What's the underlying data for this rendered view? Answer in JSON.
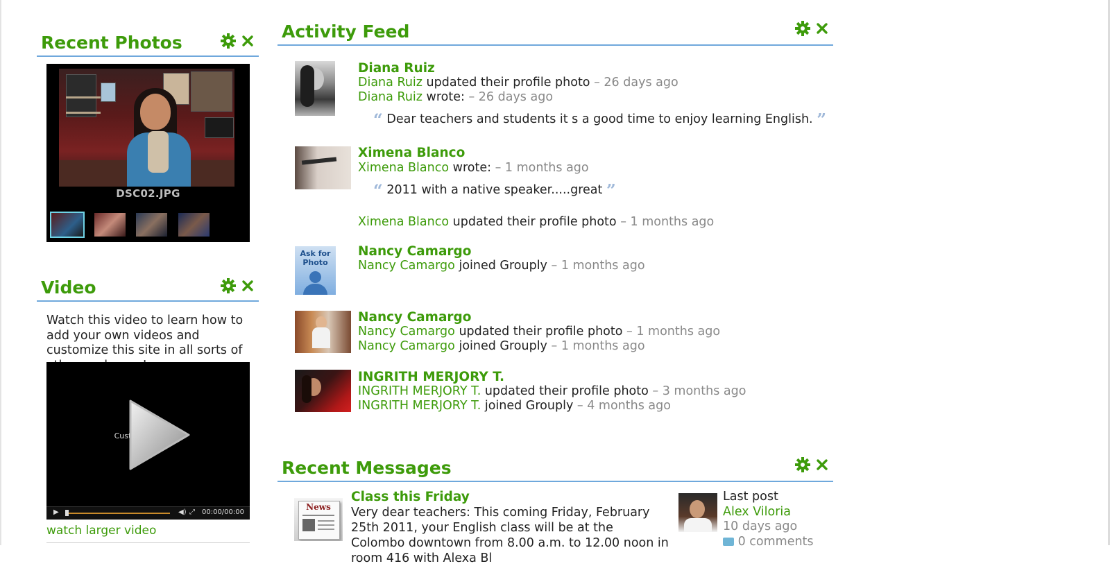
{
  "recent_photos": {
    "title": "Recent Photos",
    "caption": "DSC02.JPG",
    "thumbnail_count": 4,
    "settings_icon": "gear-icon",
    "close_icon": "close-icon"
  },
  "video": {
    "title": "Video",
    "description": "Watch this video to learn how to add your own videos and customize this site in all sorts of other cool ways!",
    "player_text": "Customize Videos",
    "time": "00:00/00:00",
    "watch_link": "watch larger video"
  },
  "activity_feed": {
    "title": "Activity Feed",
    "entries": [
      {
        "name": "Diana Ruiz",
        "lines": [
          {
            "name": "Diana Ruiz",
            "action": "updated their profile photo",
            "time": "– 26 days ago"
          },
          {
            "name": "Diana Ruiz",
            "action": "wrote:",
            "time": "– 26 days ago"
          }
        ],
        "quote": "Dear teachers and students it s a good time to enjoy learning English."
      },
      {
        "name": "Ximena Blanco",
        "lines": [
          {
            "name": "Ximena Blanco",
            "action": "wrote:",
            "time": "– 1 months ago"
          }
        ],
        "quote": "2011 with a native speaker.....great",
        "extra": {
          "name": "Ximena Blanco",
          "action": "updated their profile photo",
          "time": "– 1 months ago"
        }
      },
      {
        "name": "Nancy Camargo",
        "avatar_text": "Ask for Photo",
        "lines": [
          {
            "name": "Nancy Camargo",
            "action": "joined Grouply",
            "time": "– 1 months ago"
          }
        ]
      },
      {
        "name": "Nancy Camargo",
        "lines": [
          {
            "name": "Nancy Camargo",
            "action": "updated their profile photo",
            "time": "– 1 months ago"
          },
          {
            "name": "Nancy Camargo",
            "action": "joined Grouply",
            "time": "– 1 months ago"
          }
        ]
      },
      {
        "name": "INGRITH MERJORY T.",
        "lines": [
          {
            "name": "INGRITH MERJORY T.",
            "action": "updated their profile photo",
            "time": "– 3 months ago"
          },
          {
            "name": "INGRITH MERJORY T.",
            "action": "joined Grouply",
            "time": "– 4 months ago"
          }
        ]
      }
    ]
  },
  "recent_messages": {
    "title": "Recent Messages",
    "message": {
      "icon_text": "News",
      "title": "Class this Friday",
      "body": "Very dear teachers: This coming Friday, February 25th 2011, your English class will be at the Colombo downtown from 8.00 a.m. to 12.00 noon in room 416 with Alexa Bl",
      "last_post_label": "Last post",
      "last_post_author": "Alex Viloria",
      "last_post_time": "10 days ago",
      "comments": "0 comments"
    }
  },
  "colors": {
    "accent_green": "#3d9b0a",
    "rule_blue": "#6fa8dc",
    "muted_gray": "#888888",
    "quote_blue": "#9fb8d9"
  }
}
